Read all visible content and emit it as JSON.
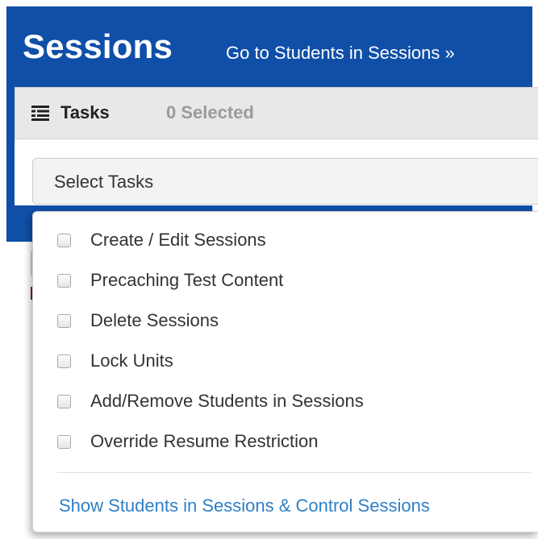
{
  "header": {
    "title": "Sessions",
    "link_label": "Go to Students in Sessions »"
  },
  "tasks": {
    "icon": "list-icon",
    "label": "Tasks",
    "selected_count": "0 Selected",
    "select_label": "Select Tasks"
  },
  "dropdown": {
    "items": [
      {
        "label": "Create / Edit Sessions",
        "checked": false
      },
      {
        "label": "Precaching Test Content",
        "checked": false
      },
      {
        "label": "Delete Sessions",
        "checked": false
      },
      {
        "label": "Lock Units",
        "checked": false
      },
      {
        "label": "Add/Remove Students in Sessions",
        "checked": false
      },
      {
        "label": "Override Resume Restriction",
        "checked": false
      }
    ],
    "footer_link": "Show Students in Sessions & Control Sessions"
  },
  "colors": {
    "header_blue": "#0f4fa8",
    "link_blue": "#2f7fc8",
    "panel_gray": "#e8e8e8"
  }
}
